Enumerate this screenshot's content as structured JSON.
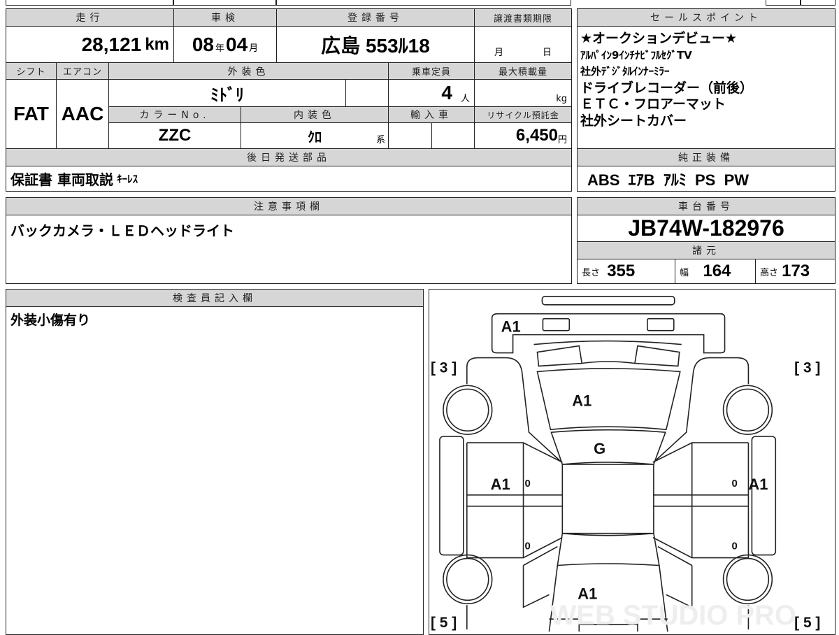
{
  "vehicle": {
    "mileage_label": "走行",
    "mileage": "28,121",
    "mileage_unit": "km",
    "inspection_label": "車検",
    "inspection_year": "08",
    "year_unit": "年",
    "inspection_month": "04",
    "month_unit": "月",
    "plate_label": "登録番号",
    "plate": "広島 553ﾙ18",
    "transfer_label": "譲渡書類期限",
    "transfer_month": "月",
    "transfer_day": "日",
    "shift_label": "シフト",
    "shift": "FAT",
    "ac_label": "エアコン",
    "ac": "AAC",
    "exterior_label": "外装色",
    "exterior": "ﾐﾄﾞﾘ",
    "capacity_label": "乗車定員",
    "capacity": "4",
    "capacity_unit": "人",
    "load_label": "最大積載量",
    "load_unit": "kg",
    "color_no_label": "カラーNo.",
    "color_no": "ZZC",
    "interior_label": "内装色",
    "interior": "ｸﾛ",
    "interior_suffix": "系",
    "import_label": "輸入車",
    "recycle_label": "リサイクル預託金",
    "recycle": "6,450",
    "recycle_unit": "円",
    "later_parts_label": "後日発送部品",
    "later_parts": "保証書 車両取説",
    "later_parts_small": "ｷｰﾚｽ"
  },
  "sales": {
    "label": "セールスポイント",
    "lines": [
      "★オークションデビュー★",
      "ｱﾙﾊﾟｲﾝ9ｲﾝﾁﾅﾋﾞﾌﾙｾｸﾞTV",
      "社外ﾃﾞｼﾞﾀﾙｲﾝﾅｰﾐﾗｰ",
      "ドライブレコーダー（前後）",
      "ＥＴＣ・フロアーマット",
      "社外シートカバー"
    ]
  },
  "equipment": {
    "label": "純正装備",
    "value": "ABS  ｴｱB  ｱﾙﾐ  PS  PW"
  },
  "notes": {
    "label": "注意事項欄",
    "value": "バックカメラ・ＬＥＤヘッドライト"
  },
  "chassis": {
    "label": "車台番号",
    "value": "JB74W-182976"
  },
  "specs": {
    "label": "諸元",
    "length_label": "長さ",
    "length": "355",
    "width_label": "幅",
    "width": "164",
    "height_label": "高さ",
    "height": "173"
  },
  "inspector": {
    "label": "検査員記入欄",
    "value": "外装小傷有り"
  },
  "diagram": {
    "marks": {
      "rear_bumper": "A1",
      "rear_glass": "A1",
      "roof": "G",
      "left_door": "A1",
      "right_door": "A1",
      "hood": "A1",
      "left_door_front": "0",
      "left_door_rear": "0",
      "right_door_front": "0",
      "right_door_rear": "0"
    },
    "tyres": {
      "front_left": "[ 3 ]",
      "front_right": "[ 3 ]",
      "rear_left": "[ 5 ]",
      "rear_right": "[ 5 ]"
    },
    "watermark": "WEB STUDIO PRO"
  }
}
